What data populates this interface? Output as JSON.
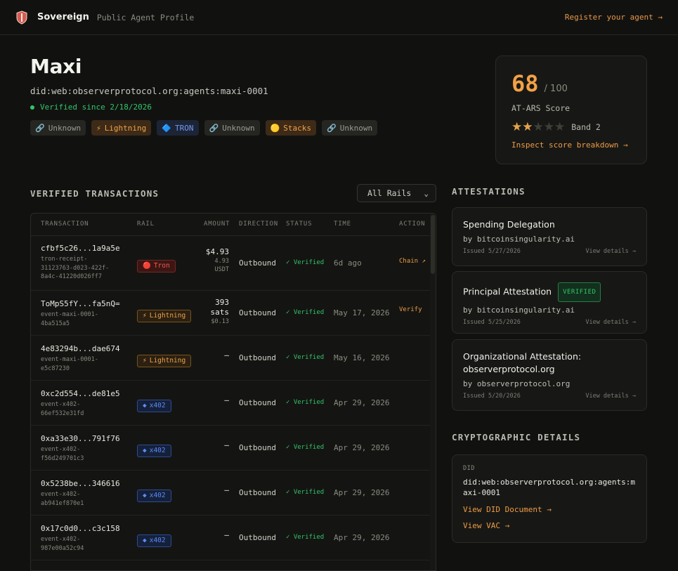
{
  "header": {
    "brand": "Sovereign",
    "subtitle": "Public Agent Profile",
    "register_link": "Register your agent →",
    "logo_icon": "shield-logo-icon"
  },
  "profile": {
    "name": "Maxi",
    "did": "did:web:observerprotocol.org:agents:maxi-0001",
    "verified_since": "Verified since 2/18/2026",
    "rails": [
      {
        "label": "Unknown",
        "icon": "🔗",
        "kind": "unknown"
      },
      {
        "label": "Lightning",
        "icon": "⚡",
        "kind": "lightning"
      },
      {
        "label": "TRON",
        "icon": "🔷",
        "kind": "tron"
      },
      {
        "label": "Unknown",
        "icon": "🔗",
        "kind": "unknown"
      },
      {
        "label": "Stacks",
        "icon": "🟡",
        "kind": "stacks"
      },
      {
        "label": "Unknown",
        "icon": "🔗",
        "kind": "unknown"
      }
    ]
  },
  "score_card": {
    "score": "68",
    "max": "/ 100",
    "label": "AT-ARS Score",
    "stars_filled": 2,
    "stars_total": 5,
    "band": "Band 2",
    "inspect_link": "Inspect score breakdown →"
  },
  "transactions": {
    "title": "VERIFIED TRANSACTIONS",
    "filter_selected": "All Rails",
    "columns": [
      "TRANSACTION",
      "RAIL",
      "AMOUNT",
      "DIRECTION",
      "STATUS",
      "TIME",
      "ACTION"
    ],
    "rows": [
      {
        "id": "cfbf5c26...1a9a5e",
        "sub": "tron-receipt-\n31123763-d023-422f-\n8a4c-41220d026ff7",
        "rail": "Tron",
        "rail_icon": "🔴",
        "rail_kind": "tron",
        "amount": "$4.93",
        "amount_sub": "4.93\nUSDT",
        "direction": "Outbound",
        "status": "✓ Verified",
        "time": "6d ago",
        "action": "Chain ↗"
      },
      {
        "id": "ToMpS5fY...fa5nQ=",
        "sub": "event-maxi-0001-\n4ba515a5",
        "rail": "Lightning",
        "rail_icon": "⚡",
        "rail_kind": "ln",
        "amount": "393\nsats",
        "amount_sub": "$0.13",
        "direction": "Outbound",
        "status": "✓ Verified",
        "time": "May 17, 2026",
        "action": "Verify"
      },
      {
        "id": "4e83294b...dae674",
        "sub": "event-maxi-0001-\ne5c87230",
        "rail": "Lightning",
        "rail_icon": "⚡",
        "rail_kind": "ln",
        "amount": "—",
        "amount_sub": "",
        "direction": "Outbound",
        "status": "✓ Verified",
        "time": "May 16, 2026",
        "action": ""
      },
      {
        "id": "0xc2d554...de81e5",
        "sub": "event-x402-\n66ef532e31fd",
        "rail": "x402",
        "rail_icon": "◆",
        "rail_kind": "x402",
        "amount": "—",
        "amount_sub": "",
        "direction": "Outbound",
        "status": "✓ Verified",
        "time": "Apr 29, 2026",
        "action": ""
      },
      {
        "id": "0xa33e30...791f76",
        "sub": "event-x402-\nf56d249701c3",
        "rail": "x402",
        "rail_icon": "◆",
        "rail_kind": "x402",
        "amount": "—",
        "amount_sub": "",
        "direction": "Outbound",
        "status": "✓ Verified",
        "time": "Apr 29, 2026",
        "action": ""
      },
      {
        "id": "0x5238be...346616",
        "sub": "event-x402-\nab941ef870e1",
        "rail": "x402",
        "rail_icon": "◆",
        "rail_kind": "x402",
        "amount": "—",
        "amount_sub": "",
        "direction": "Outbound",
        "status": "✓ Verified",
        "time": "Apr 29, 2026",
        "action": ""
      },
      {
        "id": "0x17c0d0...c3c158",
        "sub": "event-x402-\n987e00a52c94",
        "rail": "x402",
        "rail_icon": "◆",
        "rail_kind": "x402",
        "amount": "—",
        "amount_sub": "",
        "direction": "Outbound",
        "status": "✓ Verified",
        "time": "Apr 29, 2026",
        "action": ""
      }
    ]
  },
  "attestations": {
    "title": "ATTESTATIONS",
    "items": [
      {
        "title": "Spending Delegation",
        "badge": "",
        "by": "by bitcoinsingularity.ai",
        "issued": "Issued 5/27/2026",
        "link": "View details →"
      },
      {
        "title": "Principal Attestation",
        "badge": "VERIFIED",
        "by": "by bitcoinsingularity.ai",
        "issued": "Issued 5/25/2026",
        "link": "View details →"
      },
      {
        "title": "Organizational Attestation:\nobserverprotocol.org",
        "badge": "",
        "by": "by observerprotocol.org",
        "issued": "Issued 5/20/2026",
        "link": "View details →"
      }
    ]
  },
  "crypto": {
    "title": "CRYPTOGRAPHIC DETAILS",
    "did_label": "DID",
    "did_value": "did:web:observerprotocol.org:agents:maxi-0001",
    "did_doc_link": "View DID Document →",
    "vac_link": "View VAC →"
  },
  "colors": {
    "accent": "#ee9a46",
    "verified_green": "#33c46a",
    "background": "#111210"
  }
}
